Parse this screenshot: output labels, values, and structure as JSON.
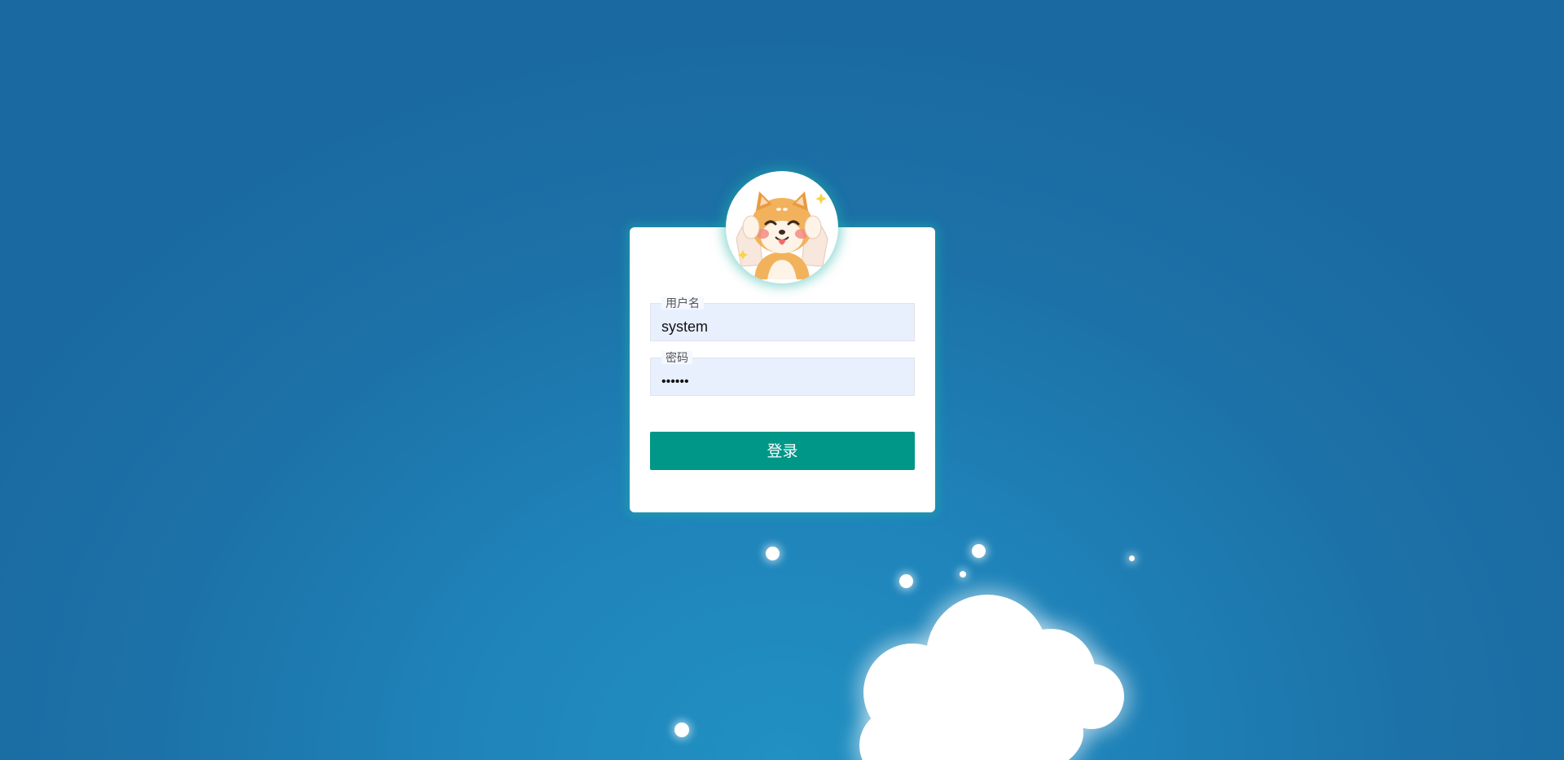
{
  "form": {
    "username_label": "用户名",
    "username_value": "system",
    "password_label": "密码",
    "password_value": "••••••",
    "login_label": "登录"
  },
  "avatar": {
    "icon": "shiba-dog-avatar-icon"
  },
  "colors": {
    "background": "#1c72a8",
    "card": "#ffffff",
    "input_bg": "#e8f0fe",
    "button": "#009688",
    "button_text": "#ffffff"
  }
}
